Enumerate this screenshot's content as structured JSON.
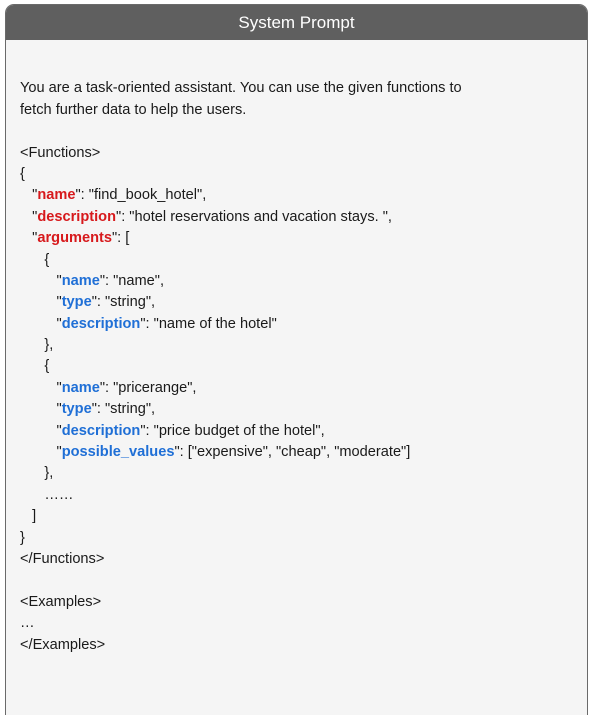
{
  "header": {
    "title": "System Prompt"
  },
  "intro": {
    "line1": "You are a task-oriented assistant. You can use the given functions to",
    "line2": "fetch further data to help the users."
  },
  "functions": {
    "open_tag": "<Functions>",
    "close_tag": "</Functions>",
    "open_brace": "{",
    "close_brace": "}",
    "name_key": "name",
    "name_value": ": \"find_book_hotel\",",
    "description_key": "description",
    "description_value": ": \"hotel reservations and vacation stays. \",",
    "arguments_key": "arguments",
    "arguments_open": ": [",
    "arguments_close": "]",
    "arg_open": "{",
    "arg_close": "},",
    "ellipsis": "……",
    "args": [
      {
        "name_key": "name",
        "name_value": ": \"name\",",
        "type_key": "type",
        "type_value": ": \"string\",",
        "description_key": "description",
        "description_value": ": \"name of the hotel\""
      },
      {
        "name_key": "name",
        "name_value": ": \"pricerange\",",
        "type_key": "type",
        "type_value": ": \"string\",",
        "description_key": "description",
        "description_value": ": \"price budget of the hotel\",",
        "possible_values_key": "possible_values",
        "possible_values_value": ": [\"expensive\", \"cheap\", \"moderate\"]"
      }
    ]
  },
  "examples": {
    "open_tag": "<Examples>",
    "ellipsis": "…",
    "close_tag": "</Examples>"
  },
  "colors": {
    "header_bg": "#5f5f5f",
    "panel_bg": "#f5f5f5",
    "top_level_key": "#d7191c",
    "nested_key": "#1f6fd6"
  }
}
